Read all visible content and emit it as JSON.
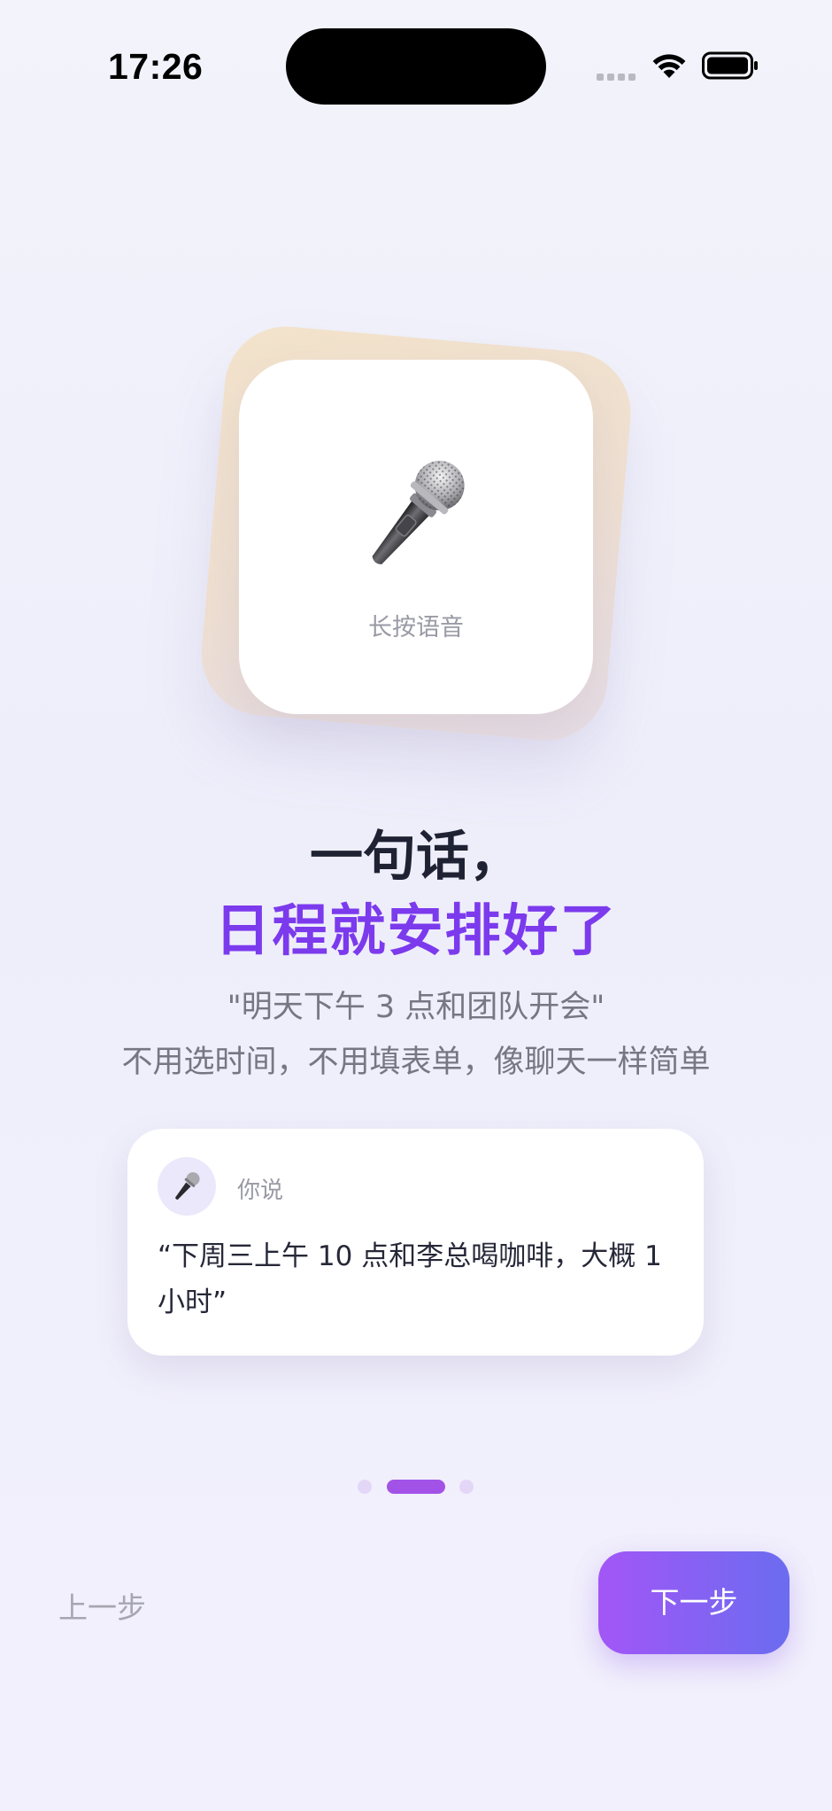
{
  "status_bar": {
    "time": "17:26"
  },
  "hero": {
    "icon": "microphone-icon",
    "caption": "长按语音"
  },
  "headline": {
    "line1": "一句话，",
    "line2": "日程就安排好了",
    "accent_color": "#7c3aed"
  },
  "subtitle": {
    "line1": "\"明天下午 3 点和团队开会\"",
    "line2": "不用选时间，不用填表单，像聊天一样简单"
  },
  "example": {
    "speaker_label": "你说",
    "avatar_icon": "microphone-icon",
    "quote": "“下周三上午 10 点和李总喝咖啡，大概 1 小时”"
  },
  "pager": {
    "total": 3,
    "current": 2
  },
  "nav": {
    "prev_label": "上一步",
    "next_label": "下一步"
  }
}
